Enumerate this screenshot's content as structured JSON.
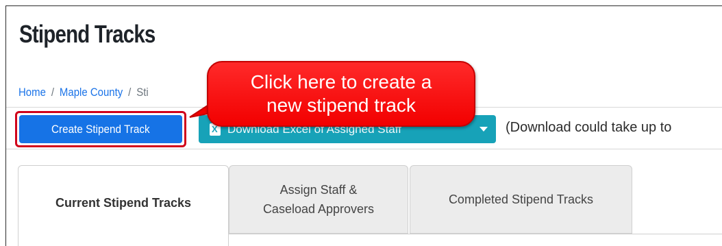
{
  "page": {
    "title": "Stipend Tracks"
  },
  "breadcrumb": {
    "home": "Home",
    "county": "Maple County",
    "current": "Sti",
    "separator": "/"
  },
  "toolbar": {
    "create_label": "Create Stipend Track",
    "download_label": "Download Excel of Assigned Staff",
    "note": "(Download could take up to"
  },
  "callout": {
    "line1": "Click here to create a",
    "line2": "new stipend track"
  },
  "tabs": [
    {
      "label": "Current Stipend Tracks"
    },
    {
      "label_line1": "Assign Staff &",
      "label_line2": "Caseload Approvers"
    },
    {
      "label": "Completed Stipend Tracks"
    }
  ],
  "icons": {
    "download_button": "excel-icon",
    "download_caret": "caret-down-icon"
  },
  "colors": {
    "primary": "#1673e6",
    "teal": "#17a2b8",
    "callout_red": "#f20000",
    "highlight_border": "#d0021b",
    "link": "#1a73e8"
  }
}
